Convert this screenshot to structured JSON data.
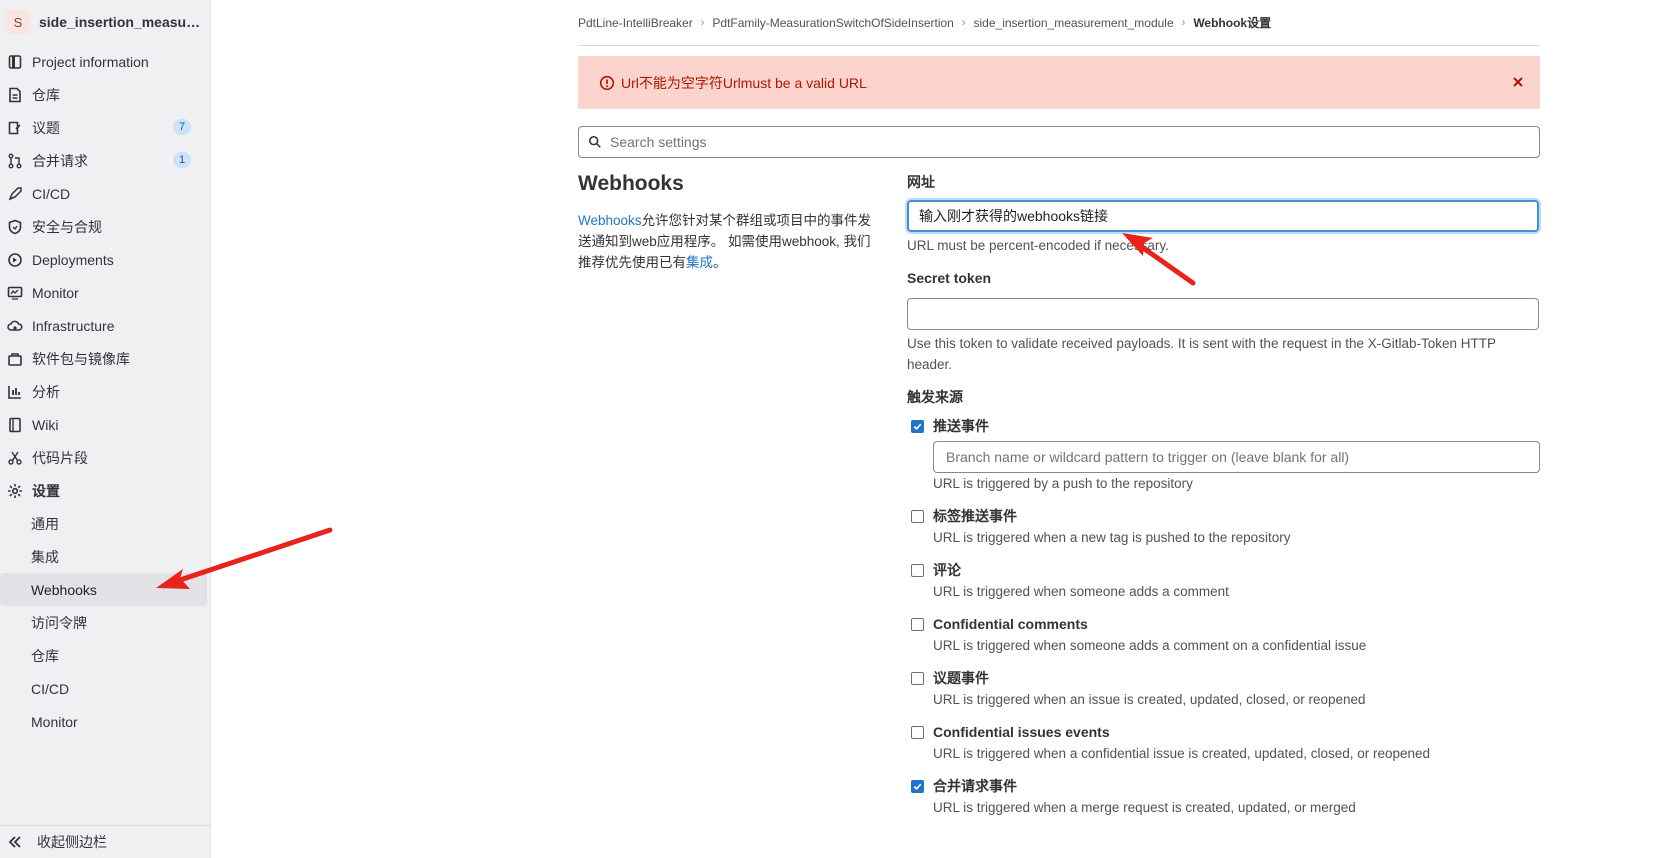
{
  "project": {
    "avatar_letter": "S",
    "name": "side_insertion_measure..."
  },
  "sidebar": {
    "items": [
      {
        "label": "Project information",
        "icon": "project-icon"
      },
      {
        "label": "仓库",
        "icon": "document-icon"
      },
      {
        "label": "议题",
        "icon": "issues-icon",
        "badge": "7"
      },
      {
        "label": "合并请求",
        "icon": "merge-request-icon",
        "badge": "1"
      },
      {
        "label": "CI/CD",
        "icon": "rocket-icon"
      },
      {
        "label": "安全与合规",
        "icon": "shield-icon"
      },
      {
        "label": "Deployments",
        "icon": "deployments-icon"
      },
      {
        "label": "Monitor",
        "icon": "monitor-icon"
      },
      {
        "label": "Infrastructure",
        "icon": "cloud-gear-icon"
      },
      {
        "label": "软件包与镜像库",
        "icon": "package-icon"
      },
      {
        "label": "分析",
        "icon": "chart-icon"
      },
      {
        "label": "Wiki",
        "icon": "book-icon"
      },
      {
        "label": "代码片段",
        "icon": "scissors-icon"
      },
      {
        "label": "设置",
        "icon": "gear-icon"
      }
    ],
    "sub_items": [
      "通用",
      "集成",
      "Webhooks",
      "访问令牌",
      "仓库",
      "CI/CD",
      "Monitor"
    ],
    "active_sub": "Webhooks",
    "collapse_label": "收起侧边栏"
  },
  "breadcrumb": [
    "PdtLine-IntelliBreaker",
    "PdtFamily-MeasurationSwitchOfSideInsertion",
    "side_insertion_measurement_module",
    "Webhook设置"
  ],
  "alert": {
    "text": "Url不能为空字符Urlmust be a valid URL",
    "color": "#fdd4cd"
  },
  "search": {
    "placeholder": "Search settings"
  },
  "webhooks_section": {
    "title": "Webhooks",
    "desc_link": "Webhooks",
    "desc_1": "允许您针对某个群组或项目中的事件发送通知到web应用程序。 如需使用webhook, 我们推荐优先使用已有",
    "desc_link2": "集成",
    "desc_end": "。"
  },
  "form": {
    "url_label": "网址",
    "url_value": "输入刚才获得的webhooks链接",
    "url_help": "URL must be percent-encoded if necessary.",
    "secret_label": "Secret token",
    "secret_value": "",
    "secret_help": "Use this token to validate received payloads. It is sent with the request in the X-Gitlab-Token HTTP header.",
    "trigger_label": "触发来源",
    "branch_placeholder": "Branch name or wildcard pattern to trigger on (leave blank for all)",
    "triggers": [
      {
        "label": "推送事件",
        "help": "URL is triggered by a push to the repository",
        "checked": true
      },
      {
        "label": "标签推送事件",
        "help": "URL is triggered when a new tag is pushed to the repository",
        "checked": false
      },
      {
        "label": "评论",
        "help": "URL is triggered when someone adds a comment",
        "checked": false
      },
      {
        "label": "Confidential comments",
        "help": "URL is triggered when someone adds a comment on a confidential issue",
        "checked": false
      },
      {
        "label": "议题事件",
        "help": "URL is triggered when an issue is created, updated, closed, or reopened",
        "checked": false
      },
      {
        "label": "Confidential issues events",
        "help": "URL is triggered when a confidential issue is created, updated, closed, or reopened",
        "checked": false
      },
      {
        "label": "合并请求事件",
        "help": "URL is triggered when a merge request is created, updated, or merged",
        "checked": true
      }
    ]
  },
  "colors": {
    "accent": "#1f75cb",
    "annotation_arrow": "#e8231d",
    "error_text": "#ae1800"
  }
}
